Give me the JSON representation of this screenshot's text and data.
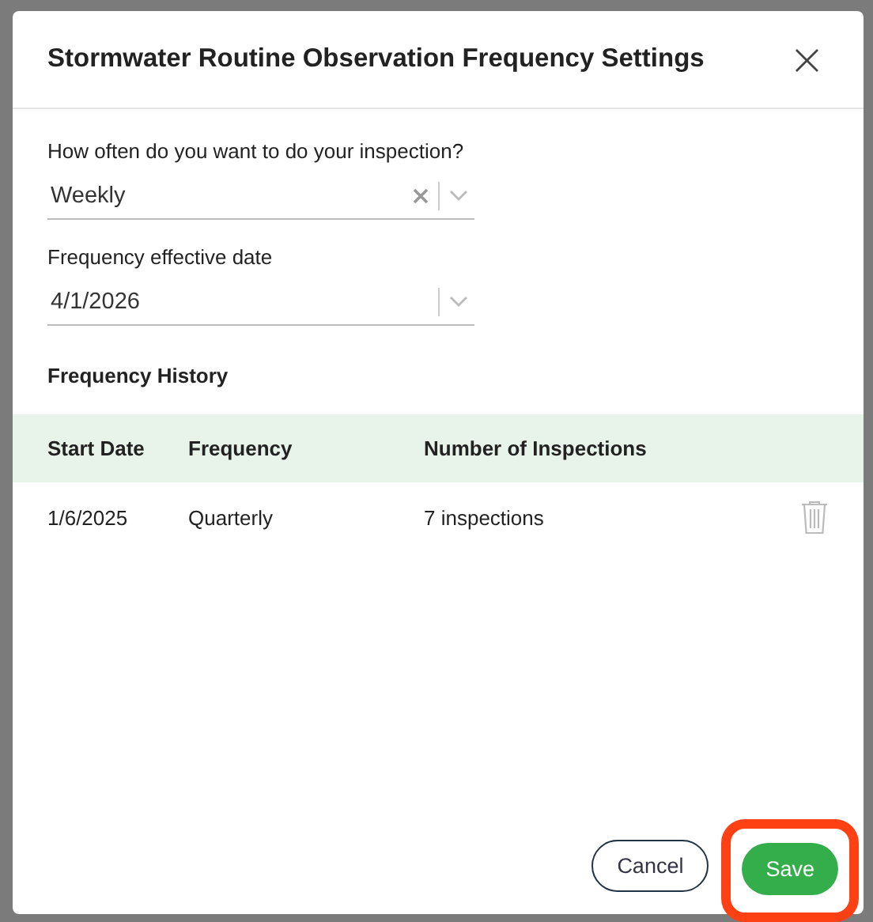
{
  "dialog": {
    "title": "Stormwater Routine Observation Frequency Settings",
    "close_icon": "×"
  },
  "fields": [
    {
      "label": "How often do you want to do your inspection?",
      "value": "Weekly",
      "clearable": true
    },
    {
      "label": "Frequency effective date",
      "value": "4/1/2026",
      "clearable": false
    }
  ],
  "history": {
    "title": "Frequency History",
    "columns": [
      "Start Date",
      "Frequency",
      "Number of Inspections"
    ],
    "rows": [
      {
        "cells": [
          "1/6/2025",
          "Quarterly",
          "7 inspections"
        ],
        "deletable": true
      }
    ]
  },
  "buttons": [
    {
      "kind": "secondary",
      "label": "Cancel",
      "highlighted": false
    },
    {
      "kind": "primary",
      "label": "Save",
      "highlighted": true
    }
  ]
}
